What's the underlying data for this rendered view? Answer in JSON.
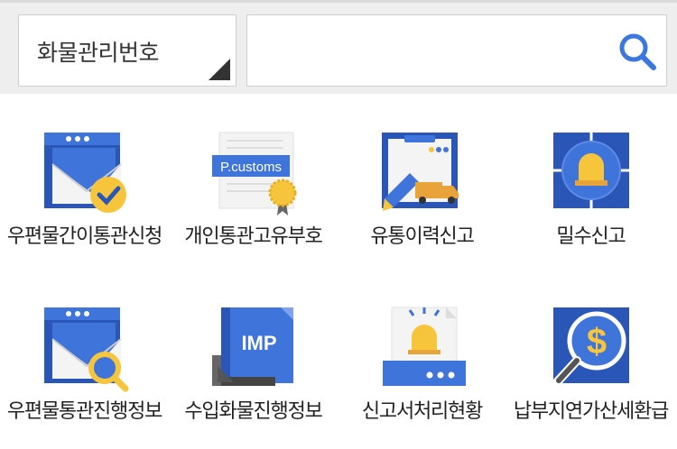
{
  "search": {
    "category_label": "화물관리번호",
    "query_value": "",
    "query_placeholder": ""
  },
  "menu": {
    "items": [
      {
        "label": "우편물간이통관신청",
        "icon": "mail-check-icon"
      },
      {
        "label": "개인통관고유부호",
        "icon": "pcustoms-certificate-icon",
        "icon_text": "P.customs"
      },
      {
        "label": "유통이력신고",
        "icon": "clipboard-truck-icon"
      },
      {
        "label": "밀수신고",
        "icon": "siren-alert-icon"
      },
      {
        "label": "우편물통관진행정보",
        "icon": "mail-search-icon"
      },
      {
        "label": "수입화물진행정보",
        "icon": "import-box-icon",
        "icon_text": "IMP"
      },
      {
        "label": "신고서처리현황",
        "icon": "report-siren-icon"
      },
      {
        "label": "납부지연가산세환급",
        "icon": "dollar-search-icon",
        "icon_text": "$"
      }
    ]
  },
  "colors": {
    "primary_blue": "#3F74DB",
    "dark_blue": "#2A56B8",
    "accent_yellow": "#F6C53B",
    "search_icon": "#3A78E0"
  }
}
